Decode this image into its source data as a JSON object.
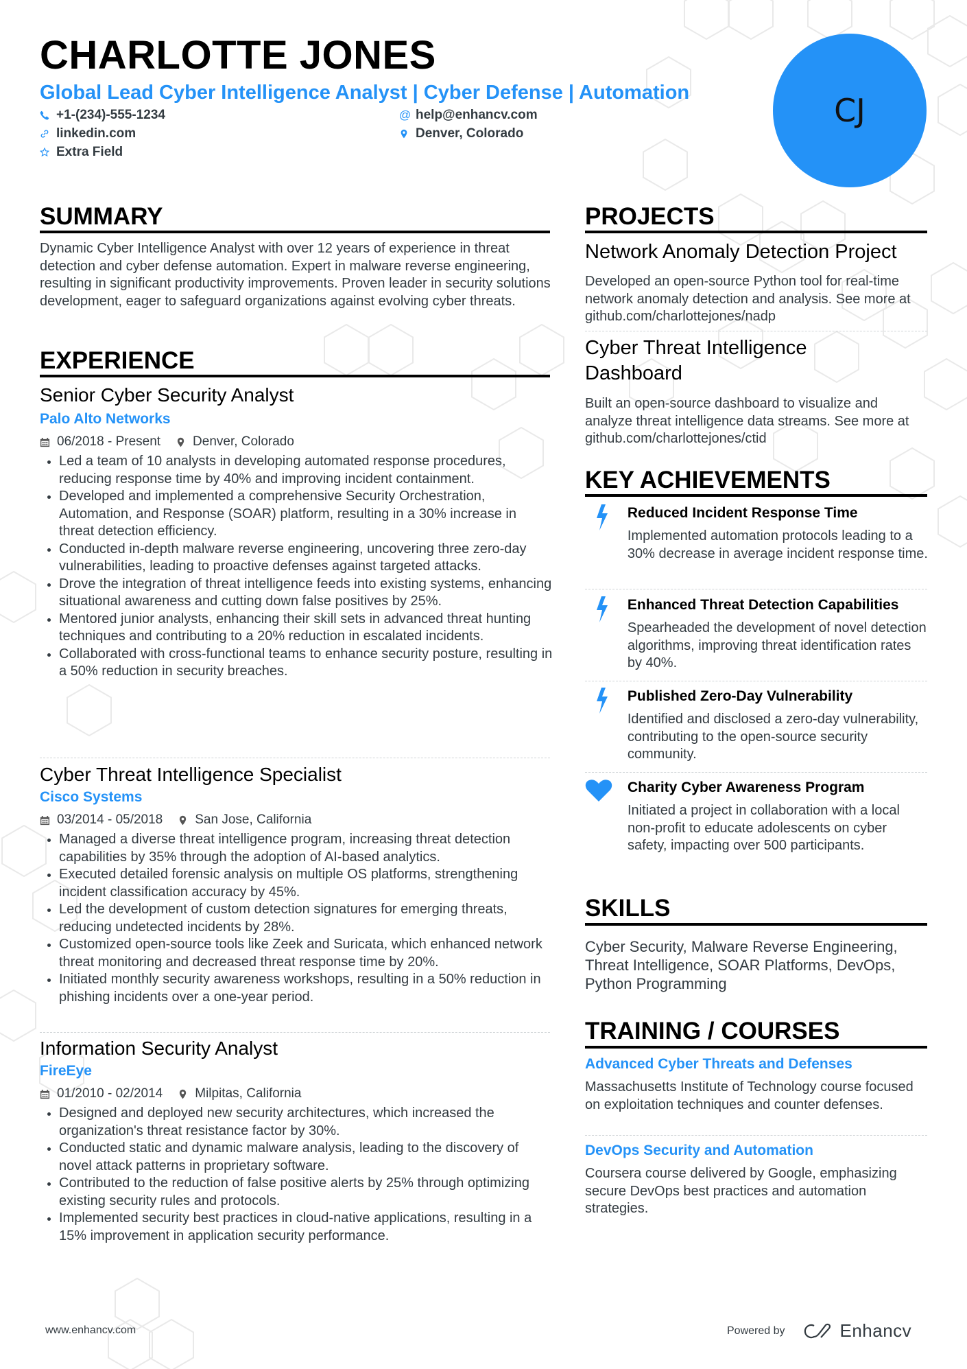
{
  "header": {
    "name": "CHARLOTTE JONES",
    "title": "Global Lead Cyber Intelligence Analyst | Cyber Defense | Automation",
    "initials": "CJ",
    "contacts": [
      {
        "icon": "phone-icon",
        "text": "+1-(234)-555-1234"
      },
      {
        "icon": "email-icon",
        "text": "help@enhancv.com"
      },
      {
        "icon": "link-icon",
        "text": "linkedin.com"
      },
      {
        "icon": "location-icon",
        "text": "Denver, Colorado"
      },
      {
        "icon": "star-icon",
        "text": "Extra Field"
      }
    ]
  },
  "colors": {
    "accent": "#2492f7",
    "text": "#333b41",
    "heading": "#000000"
  },
  "summary": {
    "heading": "SUMMARY",
    "text": "Dynamic Cyber Intelligence Analyst with over 12 years of experience in threat detection and cyber defense automation. Expert in malware reverse engineering, resulting in significant productivity improvements. Proven leader in security solutions development, eager to safeguard organizations against evolving cyber threats."
  },
  "experience": {
    "heading": "EXPERIENCE",
    "jobs": [
      {
        "title": "Senior Cyber Security Analyst",
        "company": "Palo Alto Networks",
        "dates": "06/2018 - Present",
        "location": "Denver, Colorado",
        "bullets": [
          "Led a team of 10 analysts in developing automated response procedures, reducing response time by 40% and improving incident containment.",
          "Developed and implemented a comprehensive Security Orchestration, Automation, and Response (SOAR) platform, resulting in a 30% increase in threat detection efficiency.",
          "Conducted in-depth malware reverse engineering, uncovering three zero-day vulnerabilities, leading to proactive defenses against targeted attacks.",
          "Drove the integration of threat intelligence feeds into existing systems, enhancing situational awareness and cutting down false positives by 25%.",
          "Mentored junior analysts, enhancing their skill sets in advanced threat hunting techniques and contributing to a 20% reduction in escalated incidents.",
          "Collaborated with cross-functional teams to enhance security posture, resulting in a 50% reduction in security breaches."
        ]
      },
      {
        "title": "Cyber Threat Intelligence Specialist",
        "company": "Cisco Systems",
        "dates": "03/2014 - 05/2018",
        "location": "San Jose, California",
        "bullets": [
          "Managed a diverse threat intelligence program, increasing threat detection capabilities by 35% through the adoption of AI-based analytics.",
          "Executed detailed forensic analysis on multiple OS platforms, strengthening incident classification accuracy by 45%.",
          "Led the development of custom detection signatures for emerging threats, reducing undetected incidents by 28%.",
          "Customized open-source tools like Zeek and Suricata, which enhanced network threat monitoring and decreased threat response time by 20%.",
          "Initiated monthly security awareness workshops, resulting in a 50% reduction in phishing incidents over a one-year period."
        ]
      },
      {
        "title": "Information Security Analyst",
        "company": "FireEye",
        "dates": "01/2010 - 02/2014",
        "location": "Milpitas, California",
        "bullets": [
          "Designed and deployed new security architectures, which increased the organization's threat resistance factor by 30%.",
          "Conducted static and dynamic malware analysis, leading to the discovery of novel attack patterns in proprietary software.",
          "Contributed to the reduction of false positive alerts by 25% through optimizing existing security rules and protocols.",
          "Implemented security best practices in cloud-native applications, resulting in a 15% improvement in application security performance."
        ]
      }
    ]
  },
  "projects": {
    "heading": "PROJECTS",
    "items": [
      {
        "title": "Network Anomaly Detection Project",
        "description": "Developed an open-source Python tool for real-time network anomaly detection and analysis. See more at github.com/charlottejones/nadp"
      },
      {
        "title": "Cyber Threat Intelligence Dashboard",
        "description": "Built an open-source dashboard to visualize and analyze threat intelligence data streams. See more at github.com/charlottejones/ctid"
      }
    ]
  },
  "achievements": {
    "heading": "KEY ACHIEVEMENTS",
    "items": [
      {
        "icon": "lightning-icon",
        "title": "Reduced Incident Response Time",
        "description": "Implemented automation protocols leading to a 30% decrease in average incident response time."
      },
      {
        "icon": "lightning-icon",
        "title": "Enhanced Threat Detection Capabilities",
        "description": "Spearheaded the development of novel detection algorithms, improving threat identification rates by 40%."
      },
      {
        "icon": "lightning-icon",
        "title": "Published Zero-Day Vulnerability",
        "description": "Identified and disclosed a zero-day vulnerability, contributing to the open-source security community."
      },
      {
        "icon": "heart-icon",
        "title": "Charity Cyber Awareness Program",
        "description": "Initiated a project in collaboration with a local non-profit to educate adolescents on cyber safety, impacting over 500 participants."
      }
    ]
  },
  "skills": {
    "heading": "SKILLS",
    "text": "Cyber Security, Malware Reverse Engineering, Threat Intelligence, SOAR Platforms, DevOps, Python Programming"
  },
  "training": {
    "heading": "TRAINING / COURSES",
    "items": [
      {
        "title": "Advanced Cyber Threats and Defenses",
        "description": "Massachusetts Institute of Technology course focused on exploitation techniques and counter defenses."
      },
      {
        "title": "DevOps Security and Automation",
        "description": "Coursera course delivered by Google, emphasizing secure DevOps best practices and automation strategies."
      }
    ]
  },
  "footer": {
    "website": "www.enhancv.com",
    "powered_by": "Powered by",
    "brand": "Enhancv"
  }
}
